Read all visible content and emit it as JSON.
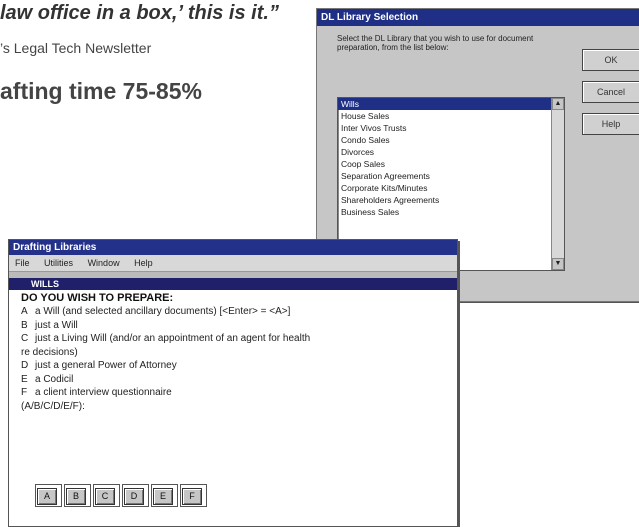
{
  "article": {
    "quote": "law office in a box,’ this is it.”",
    "source": "’s Legal Tech Newsletter",
    "headline": "afting time 75-85%"
  },
  "library_dialog": {
    "title": "DL Library Selection",
    "prompt": "Select the DL Library that you wish to use for document preparation, from the list below:",
    "items": [
      "Wills",
      "House Sales",
      "Inter Vivos Trusts",
      "Condo Sales",
      "Divorces",
      "Coop Sales",
      "Separation Agreements",
      "Corporate Kits/Minutes",
      "Shareholders Agreements",
      "Business Sales"
    ],
    "selected_index": 0,
    "buttons": {
      "ok": "OK",
      "cancel": "Cancel",
      "help": "Help"
    }
  },
  "drafting_window": {
    "title": "Drafting Libraries",
    "menu": [
      "File",
      "Utilities",
      "Window",
      "Help"
    ],
    "section": "WILLS",
    "heading": "DO YOU WISH TO PREPARE:",
    "options": [
      {
        "letter": "A",
        "text": "a Will (and selected ancillary documents)   [<Enter> = <A>]"
      },
      {
        "letter": "B",
        "text": "just a Will"
      },
      {
        "letter": "C",
        "text": "just a Living Will (and/or an appointment of an agent for health"
      },
      {
        "letter": "",
        "text": "re decisions)"
      },
      {
        "letter": "D",
        "text": "just a general Power of Attorney"
      },
      {
        "letter": "E",
        "text": "a Codicil"
      },
      {
        "letter": "F",
        "text": "a client interview questionnaire"
      }
    ],
    "prompt_line": "(A/B/C/D/E/F):",
    "choice_buttons": [
      "A",
      "B",
      "C",
      "D",
      "E",
      "F"
    ]
  }
}
